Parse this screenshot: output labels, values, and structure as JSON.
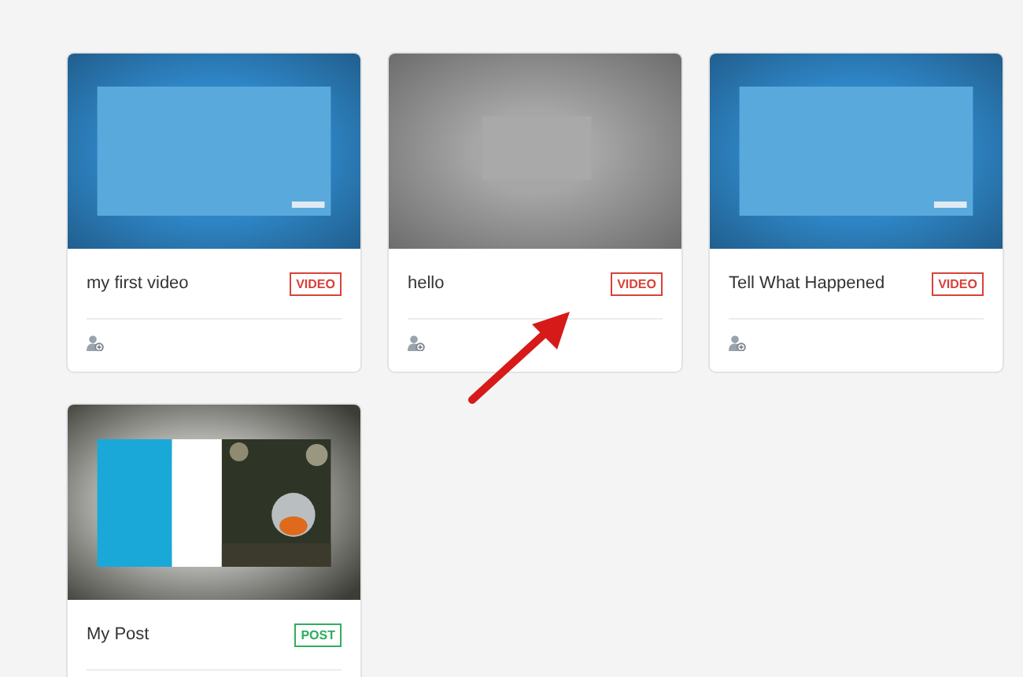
{
  "cards": [
    {
      "title": "my first video",
      "badge": {
        "label": "VIDEO",
        "kind": "video"
      }
    },
    {
      "title": "hello",
      "badge": {
        "label": "VIDEO",
        "kind": "video"
      }
    },
    {
      "title": "Tell What Happened",
      "badge": {
        "label": "VIDEO",
        "kind": "video"
      }
    },
    {
      "title": "My Post",
      "badge": {
        "label": "POST",
        "kind": "post"
      }
    }
  ]
}
